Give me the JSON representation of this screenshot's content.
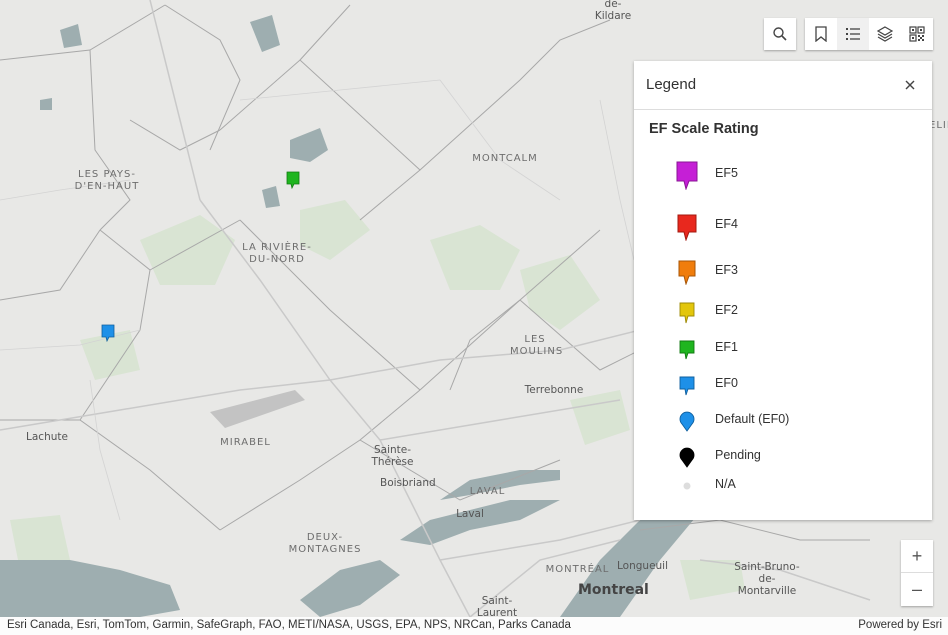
{
  "map": {
    "places": [
      {
        "id": "les-pays",
        "text": "LES PAYS-\nD'EN-HAUT"
      },
      {
        "id": "riviere-du-nord",
        "text": "LA RIVIÈRE-\nDU-NORD"
      },
      {
        "id": "montcalm",
        "text": "MONTCALM"
      },
      {
        "id": "les-moulins",
        "text": "LES\nMOULINS"
      },
      {
        "id": "terrebonne",
        "text": "Terrebonne"
      },
      {
        "id": "mirabel",
        "text": "MIRABEL"
      },
      {
        "id": "lachute",
        "text": "Lachute"
      },
      {
        "id": "sainte-therese",
        "text": "Sainte-\nThérèse"
      },
      {
        "id": "boisbriand",
        "text": "Boisbriand"
      },
      {
        "id": "laval-region",
        "text": "LAVAL"
      },
      {
        "id": "laval-city",
        "text": "Laval"
      },
      {
        "id": "deux-montagnes",
        "text": "DEUX-\nMONTAGNES"
      },
      {
        "id": "montreal-region",
        "text": "MONTRÉAL"
      },
      {
        "id": "longueuil",
        "text": "Longueuil"
      },
      {
        "id": "st-bruno",
        "text": "Saint-Bruno-de-\nMontarville"
      },
      {
        "id": "montreal",
        "text": "Montreal"
      },
      {
        "id": "saint-laurent",
        "text": "Saint-Laurent"
      },
      {
        "id": "de-kildare",
        "text": "de-Kildare"
      },
      {
        "id": "edge-right",
        "text": "ELIE"
      }
    ],
    "markers": [
      {
        "id": "marker-ef1",
        "rating": "EF1",
        "color": "#1fb51f"
      },
      {
        "id": "marker-ef0",
        "rating": "EF0",
        "color": "#1e90e8"
      }
    ]
  },
  "toolbar": {
    "search_icon": "search-icon",
    "bookmark_icon": "bookmark-icon",
    "legend_icon": "legend-list-icon",
    "layers_icon": "layers-icon",
    "qr_icon": "qr-code-icon"
  },
  "legend": {
    "title": "Legend",
    "layer_title": "EF Scale Rating",
    "items": [
      {
        "label": "EF5",
        "color": "#c51fd6",
        "size": "xl"
      },
      {
        "label": "EF4",
        "color": "#e8281e",
        "size": "lg"
      },
      {
        "label": "EF3",
        "color": "#f07d0c",
        "size": "md"
      },
      {
        "label": "EF2",
        "color": "#e3c60c",
        "size": "sm"
      },
      {
        "label": "EF1",
        "color": "#1fb51f",
        "size": "sm"
      },
      {
        "label": "EF0",
        "color": "#1e90e8",
        "size": "sm"
      },
      {
        "label": "Default (EF0)",
        "color": "#1e90e8",
        "size": "round"
      },
      {
        "label": "Pending",
        "color": "#000000",
        "size": "round"
      },
      {
        "label": "N/A",
        "color": "#dddddd",
        "size": "dot"
      }
    ]
  },
  "zoom": {
    "in": "+",
    "out": "–"
  },
  "attribution": {
    "text": "Esri Canada, Esri, TomTom, Garmin, SafeGraph, FAO, METI/NASA, USGS, EPA, NPS, NRCan, Parks Canada",
    "powered": "Powered by Esri"
  }
}
